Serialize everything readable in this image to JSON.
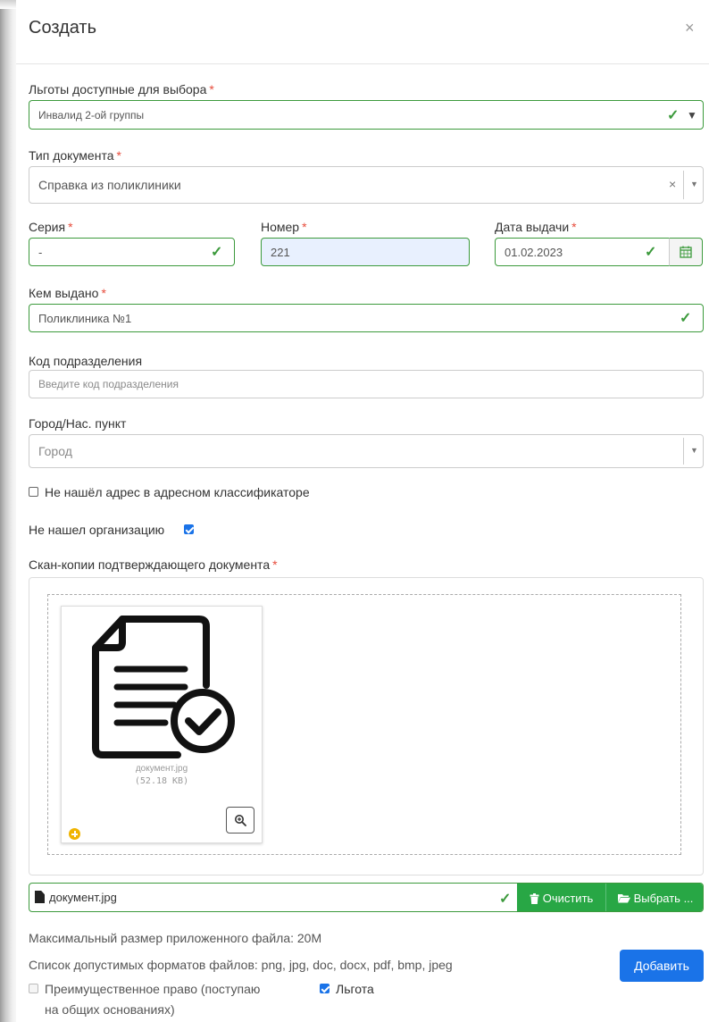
{
  "dialog": {
    "title": "Создать",
    "close_symbol": "×"
  },
  "benefits": {
    "label": "Льготы доступные для выбора",
    "value": "Инвалид 2-ой группы"
  },
  "doc_type": {
    "label": "Тип документа",
    "value": "Справка из поликлиники"
  },
  "series": {
    "label": "Серия",
    "value": "-"
  },
  "number": {
    "label": "Номер",
    "value": "221"
  },
  "issue_date": {
    "label": "Дата выдачи",
    "value": "01.02.2023"
  },
  "issued_by": {
    "label": "Кем выдано",
    "value": "Поликлиника №1"
  },
  "division_code": {
    "label": "Код подразделения",
    "placeholder": "Введите код подразделения"
  },
  "city": {
    "label": "Город/Нас. пункт",
    "placeholder": "Город"
  },
  "no_address": {
    "label": "Не нашёл адрес в адресном классификаторе",
    "checked": false
  },
  "no_org": {
    "label": "Не нашел организацию",
    "checked": true
  },
  "scans": {
    "label": "Скан-копии подтверждающего документа",
    "file_name": "документ.jpg",
    "file_size": "(52.18 KB)",
    "clear_label": "Очистить",
    "choose_label": "Выбрать ..."
  },
  "info": {
    "max_size": "Максимальный размер приложенного файла: 20M",
    "formats": "Список допустимых форматов файлов: png, jpg, doc, docx, pdf, bmp, jpeg"
  },
  "preference": {
    "label_line1": "Преимущественное право (поступаю",
    "label_line2": "на общих основаниях)",
    "checked": false
  },
  "benefit_check": {
    "label": "Льгота",
    "checked": true
  },
  "add_label": "Добавить",
  "colors": {
    "success": "#3c9a3c",
    "primary": "#1a73e8",
    "required": "#e74c3c",
    "button_green": "#28a745"
  }
}
